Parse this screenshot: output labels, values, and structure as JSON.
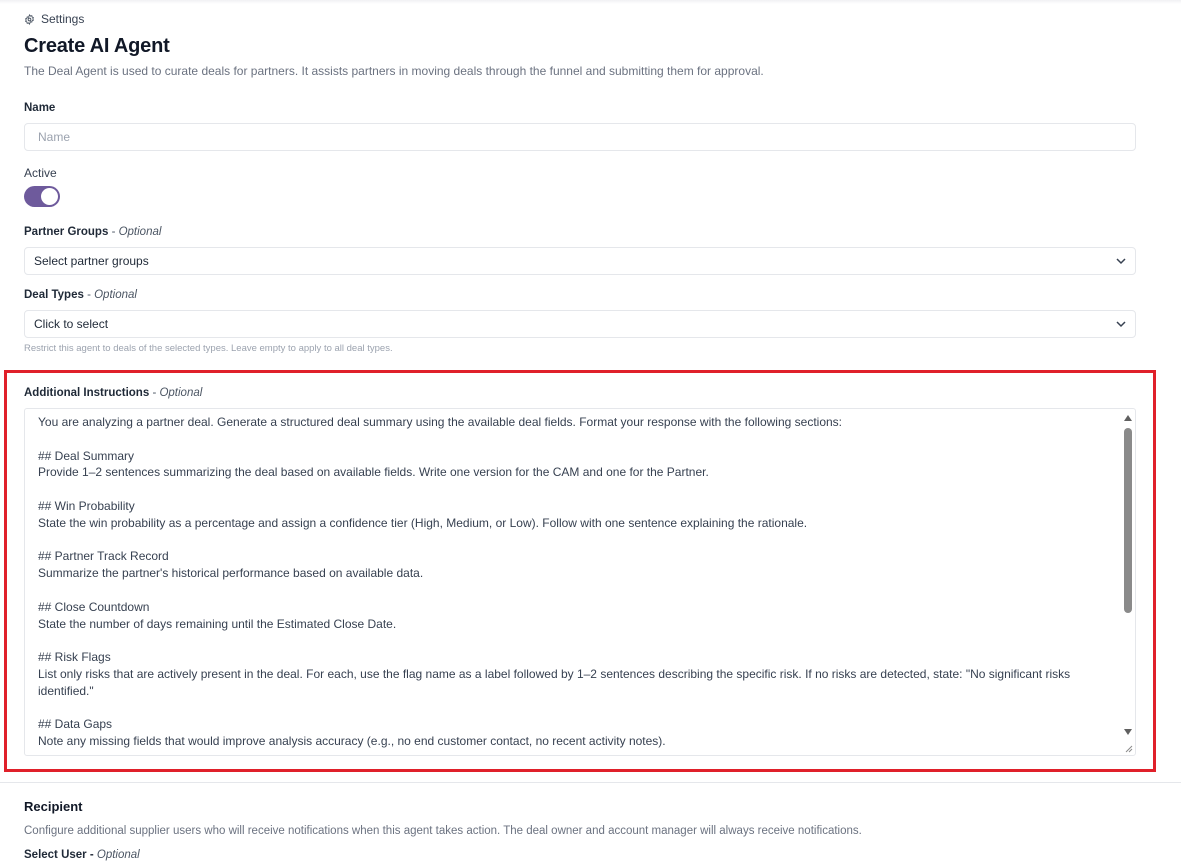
{
  "breadcrumb": {
    "icon": "gear-icon",
    "label": "Settings"
  },
  "page": {
    "title": "Create AI Agent",
    "subtitle": "The Deal Agent is used to curate deals for partners. It assists partners in moving deals through the funnel and submitting them for approval."
  },
  "form": {
    "name": {
      "label": "Name",
      "value": "",
      "placeholder": "Name"
    },
    "active": {
      "label": "Active",
      "checked": true,
      "accent": "#6e5a9c"
    },
    "partner_groups": {
      "label": "Partner Groups",
      "optional": "Optional",
      "value": "Select partner groups"
    },
    "deal_types": {
      "label": "Deal Types",
      "optional": "Optional",
      "value": "Click to select",
      "hint": "Restrict this agent to deals of the selected types. Leave empty to apply to all deal types."
    },
    "instructions": {
      "label": "Additional Instructions",
      "optional": "Optional",
      "lines": [
        "You are analyzing a partner deal. Generate a structured deal summary using the available deal fields. Format your response with the following sections:",
        "",
        "## Deal Summary",
        "Provide 1–2 sentences summarizing the deal based on available fields. Write one version for the CAM and one for the Partner.",
        "",
        "## Win Probability",
        "State the win probability as a percentage and assign a confidence tier (High, Medium, or Low). Follow with one sentence explaining the rationale.",
        "",
        "## Partner Track Record",
        "Summarize the partner's historical performance based on available data.",
        "",
        "## Close Countdown",
        "State the number of days remaining until the Estimated Close Date.",
        "",
        "## Risk Flags",
        "List only risks that are actively present in the deal. For each, use the flag name as a label followed by 1–2 sentences describing the specific risk. If no risks are detected, state: \"No significant risks",
        "identified.\"",
        "",
        "## Data Gaps",
        "Note any missing fields that would improve analysis accuracy (e.g., no end customer contact, no recent activity notes)."
      ],
      "highlight_color": "#e0202a"
    }
  },
  "recipient": {
    "title": "Recipient",
    "description": "Configure additional supplier users who will receive notifications when this agent takes action. The deal owner and account manager will always receive notifications.",
    "select_user_label": "Select User",
    "optional": "Optional"
  }
}
